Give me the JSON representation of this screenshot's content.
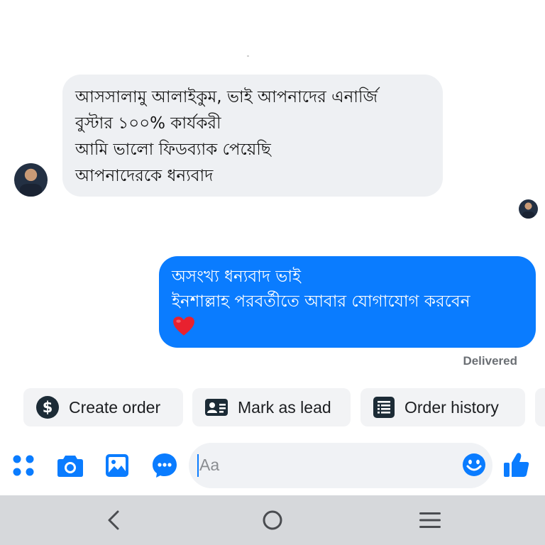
{
  "conversation": {
    "incoming": {
      "lines": [
        "আসসালামু আলাইকুম, ভাই আপনাদের এনার্জি",
        "বুস্টার  ১০০% কার্যকরী",
        "আমি ভালো ফিডব্যাক পেয়েছি",
        "আপনাদেরকে ধন্যবাদ"
      ]
    },
    "outgoing": {
      "lines": [
        "অসংখ্য ধন্যবাদ ভাই",
        "ইনশাল্লাহ পরবর্তীতে আবার যোগাযোগ করবেন"
      ],
      "emoji": "red-heart"
    },
    "status": "Delivered"
  },
  "quick_actions": [
    {
      "label": "Create order",
      "icon": "dollar-circle-icon"
    },
    {
      "label": "Mark as lead",
      "icon": "contact-card-icon"
    },
    {
      "label": "Order history",
      "icon": "receipt-list-icon"
    }
  ],
  "composer": {
    "placeholder": "Aa",
    "left_icons": [
      "apps-icon",
      "camera-icon",
      "image-icon",
      "chat-icon"
    ],
    "right_icon": "thumbs-up-icon"
  },
  "system_nav": [
    "back-icon",
    "home-icon",
    "recents-icon"
  ],
  "colors": {
    "accent": "#0a7cff",
    "incoming_bubble": "#eef0f3",
    "nav_bar": "#d6d8db"
  }
}
